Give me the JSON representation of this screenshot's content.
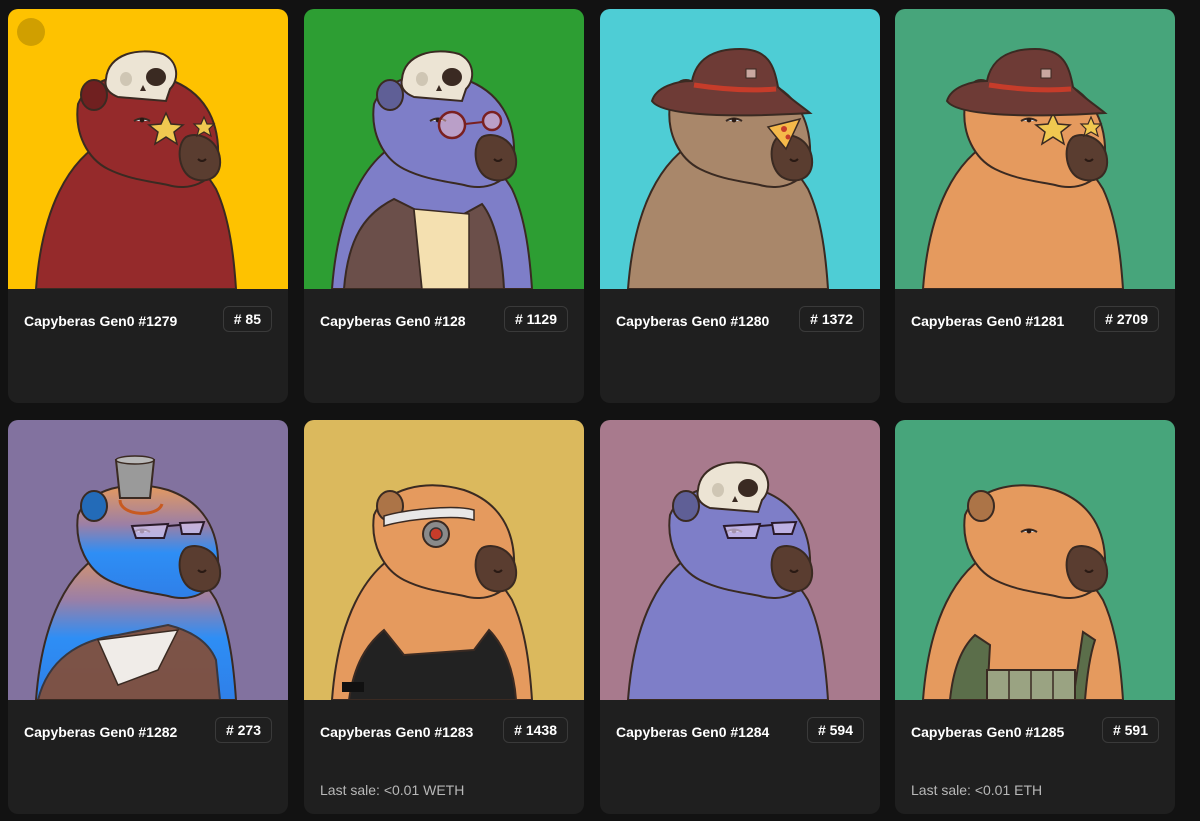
{
  "cards": [
    {
      "name": "Capyberas Gen0 #1279",
      "rank": "# 85",
      "last_sale": "",
      "bg": "#fec200",
      "fur": "#952a2b",
      "hat": "skull",
      "eye": "star"
    },
    {
      "name": "Capyberas Gen0 #128",
      "rank": "# 1129",
      "last_sale": "",
      "bg": "#2d9e33",
      "fur": "#7e7ec8",
      "hat": "skull",
      "eye": "round-glasses",
      "outfit": "jacket"
    },
    {
      "name": "Capyberas Gen0 #1280",
      "rank": "# 1372",
      "last_sale": "",
      "bg": "#4ecdd5",
      "fur": "#a9876a",
      "hat": "cowboy",
      "eye": "pizza"
    },
    {
      "name": "Capyberas Gen0 #1281",
      "rank": "# 2709",
      "last_sale": "",
      "bg": "#47a57b",
      "fur": "#e59a5e",
      "hat": "cowboy",
      "eye": "star"
    },
    {
      "name": "Capyberas Gen0 #1282",
      "rank": "# 273",
      "last_sale": "",
      "bg": "#82729f",
      "fur": "#2e8ef5",
      "hat": "bucket",
      "eye": "sunglasses",
      "outfit": "poncho"
    },
    {
      "name": "Capyberas Gen0 #1283",
      "rank": "# 1438",
      "last_sale": "Last sale: <0.01 WETH",
      "bg": "#dbb95d",
      "fur": "#e59a5e",
      "hat": "headband",
      "eye": "cyborg",
      "outfit": "tank"
    },
    {
      "name": "Capyberas Gen0 #1284",
      "rank": "# 594",
      "last_sale": "",
      "bg": "#a87a8d",
      "fur": "#7e7ec8",
      "hat": "skull",
      "eye": "sunglasses"
    },
    {
      "name": "Capyberas Gen0 #1285",
      "rank": "# 591",
      "last_sale": "Last sale: <0.01 ETH",
      "bg": "#47a57b",
      "fur": "#e59a5e",
      "hat": "none",
      "eye": "none",
      "outfit": "vest"
    }
  ]
}
